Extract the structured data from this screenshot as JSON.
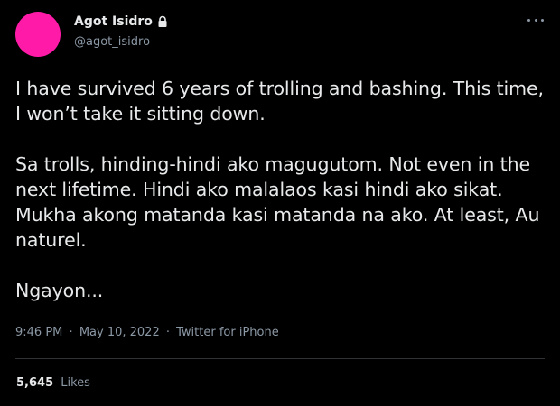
{
  "colors": {
    "background": "#000000",
    "avatar": "#ff1aa8",
    "primary_text": "#e7e9ea",
    "secondary_text": "#8b98a5",
    "divider": "#2f3336"
  },
  "author": {
    "name": "Agot Isidro",
    "handle": "@agot_isidro",
    "protected_icon": "lock-icon",
    "avatar_icon": "avatar"
  },
  "menu": {
    "icon": "more-icon"
  },
  "tweet": {
    "paragraphs": [
      "I have survived 6 years of trolling and bashing. This time, I won’t take it sitting down.",
      "Sa trolls, hinding-hindi ako magugutom. Not even in the next lifetime. Hindi ako malalaos kasi hindi ako sikat. Mukha akong matanda kasi matanda na ako. At least, Au naturel.",
      "Ngayon..."
    ]
  },
  "meta": {
    "time": "9:46 PM",
    "separator": "·",
    "date": "May 10, 2022",
    "source": "Twitter for iPhone"
  },
  "stats": {
    "likes_count": "5,645",
    "likes_label": "Likes"
  }
}
